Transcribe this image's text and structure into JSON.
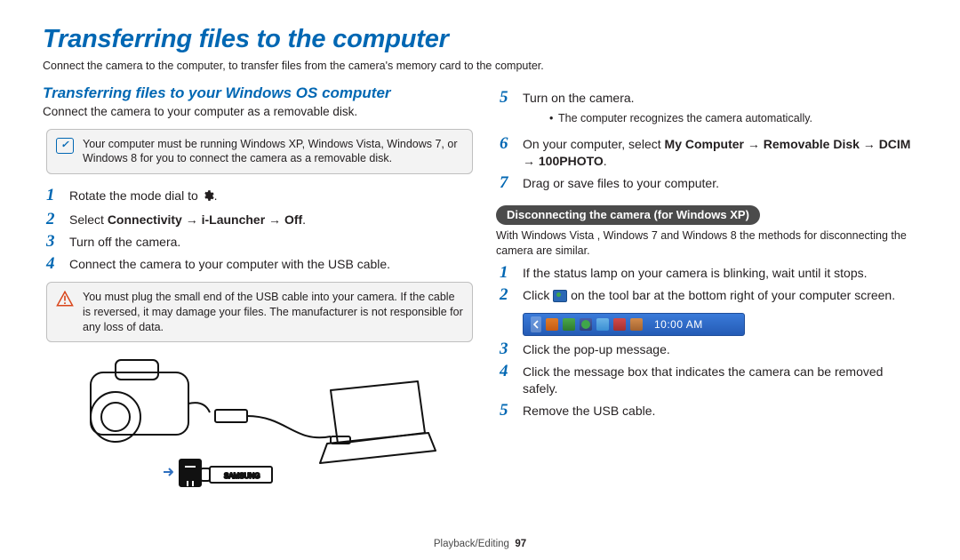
{
  "title": "Transferring files to the computer",
  "intro": "Connect the camera to the computer, to transfer files from the camera's memory card to the computer.",
  "left": {
    "heading": "Transferring files to your Windows OS computer",
    "sub": "Connect the camera to your computer as a removable disk.",
    "note": "Your computer must be running Windows XP, Windows Vista, Windows 7, or Windows 8 for you to connect the camera as a removable disk.",
    "steps": {
      "s1": {
        "num": "1",
        "pre": "Rotate the mode dial to ",
        "post": "."
      },
      "s2": {
        "num": "2",
        "pre": "Select ",
        "b": "Connectivity → i-Launcher → Off",
        "post": "."
      },
      "s3": {
        "num": "3",
        "text": "Turn off the camera."
      },
      "s4": {
        "num": "4",
        "text": "Connect the camera to your computer with the USB cable."
      }
    },
    "warn": "You must plug the small end of the USB cable into your camera. If the cable is reversed, it may damage your files. The manufacturer is not responsible for any loss of data."
  },
  "right": {
    "steps_a": {
      "s5": {
        "num": "5",
        "text": "Turn on the camera.",
        "bullet": "The computer recognizes the camera automatically."
      },
      "s6": {
        "num": "6",
        "pre": "On your computer, select ",
        "b": "My Computer → Removable Disk → DCIM → 100PHOTO",
        "post": "."
      },
      "s7": {
        "num": "7",
        "text": "Drag or save files to your computer."
      }
    },
    "pill": "Disconnecting the camera (for Windows XP)",
    "pill_sub": "With Windows Vista , Windows 7 and Windows 8 the methods for disconnecting the camera are similar.",
    "steps_b": {
      "s1": {
        "num": "1",
        "text": "If the status lamp on your camera is blinking, wait until it stops."
      },
      "s2": {
        "num": "2",
        "pre": "Click ",
        "post": " on the tool bar at the bottom right of your computer screen."
      },
      "s3": {
        "num": "3",
        "text": "Click the pop-up message."
      },
      "s4": {
        "num": "4",
        "text": "Click the message box that indicates the camera can be removed safely."
      },
      "s5": {
        "num": "5",
        "text": "Remove the USB cable."
      }
    },
    "taskbar_time": "10:00 AM"
  },
  "footer": {
    "section": "Playback/Editing",
    "page": "97"
  }
}
